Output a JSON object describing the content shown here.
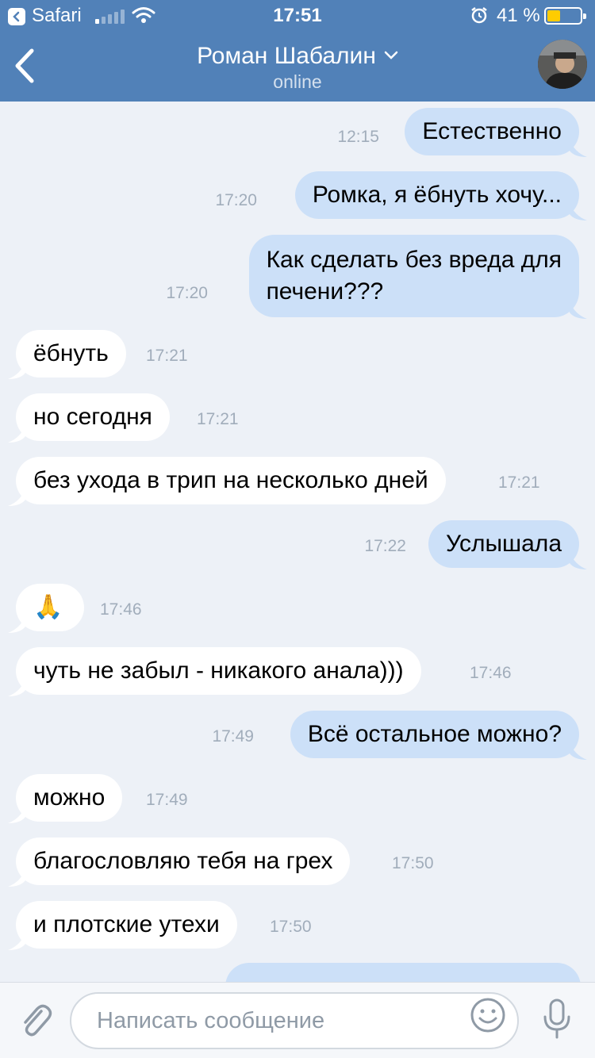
{
  "status_bar": {
    "carrier": "Safari",
    "time": "17:51",
    "battery_pct": "41 %",
    "battery_level": 0.41
  },
  "header": {
    "contact_name": "Роман Шабалин",
    "status": "online"
  },
  "messages": [
    {
      "dir": "out",
      "text": "Естественно",
      "time": "12:15"
    },
    {
      "dir": "out",
      "text": "Ромка, я ёбнуть хочу...",
      "time": "17:20"
    },
    {
      "dir": "out",
      "text": "Как сделать без вреда для\nпечени???",
      "time": "17:20"
    },
    {
      "dir": "in",
      "text": "ёбнуть",
      "time": "17:21"
    },
    {
      "dir": "in",
      "text": "но сегодня",
      "time": "17:21"
    },
    {
      "dir": "in",
      "text": "без ухода в трип на несколько дней",
      "time": "17:21"
    },
    {
      "dir": "out",
      "text": "Услышала",
      "time": "17:22"
    },
    {
      "dir": "in",
      "text": "🙏",
      "time": "17:46"
    },
    {
      "dir": "in",
      "text": "чуть не забыл - никакого анала)))",
      "time": "17:46"
    },
    {
      "dir": "out",
      "text": "Всё остальное можно?",
      "time": "17:49"
    },
    {
      "dir": "in",
      "text": "можно",
      "time": "17:49"
    },
    {
      "dir": "in",
      "text": "благословляю тебя на грех",
      "time": "17:50"
    },
    {
      "dir": "in",
      "text": "и плотские утехи",
      "time": "17:50"
    }
  ],
  "composer": {
    "placeholder": "Написать сообщение"
  },
  "colors": {
    "header_bg": "#5181b8",
    "outgoing_bubble": "#cce0f8",
    "incoming_bubble": "#ffffff",
    "chat_bg": "#edf1f7"
  },
  "icons": [
    "back-icon",
    "chevron-down-icon",
    "attach-icon",
    "smile-icon",
    "mic-icon",
    "wifi-icon",
    "alarm-icon",
    "battery-icon"
  ]
}
